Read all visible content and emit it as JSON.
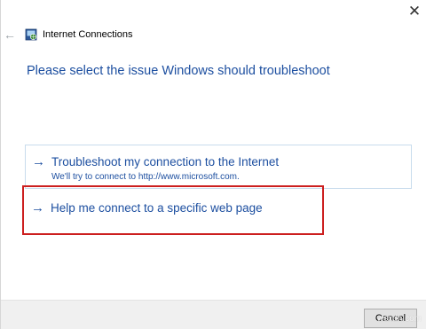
{
  "window": {
    "close_glyph": "✕",
    "back_glyph": "←"
  },
  "header": {
    "title": "Internet Connections",
    "icon": "network-globe-icon"
  },
  "main": {
    "heading": "Please select the issue Windows should troubleshoot",
    "options": [
      {
        "label": "Troubleshoot my connection to the Internet",
        "description": "We'll try to connect to http://www.microsoft.com.",
        "icon": "arrow-right-icon"
      },
      {
        "label": "Help me connect to a specific web page",
        "icon": "arrow-right-icon"
      }
    ]
  },
  "footer": {
    "cancel_label": "Cancel"
  },
  "watermark": "wsxdn.com",
  "colors": {
    "link_blue": "#1d4fa0",
    "highlight_red": "#cc1f1f",
    "footer_bg": "#f0f0f0"
  }
}
